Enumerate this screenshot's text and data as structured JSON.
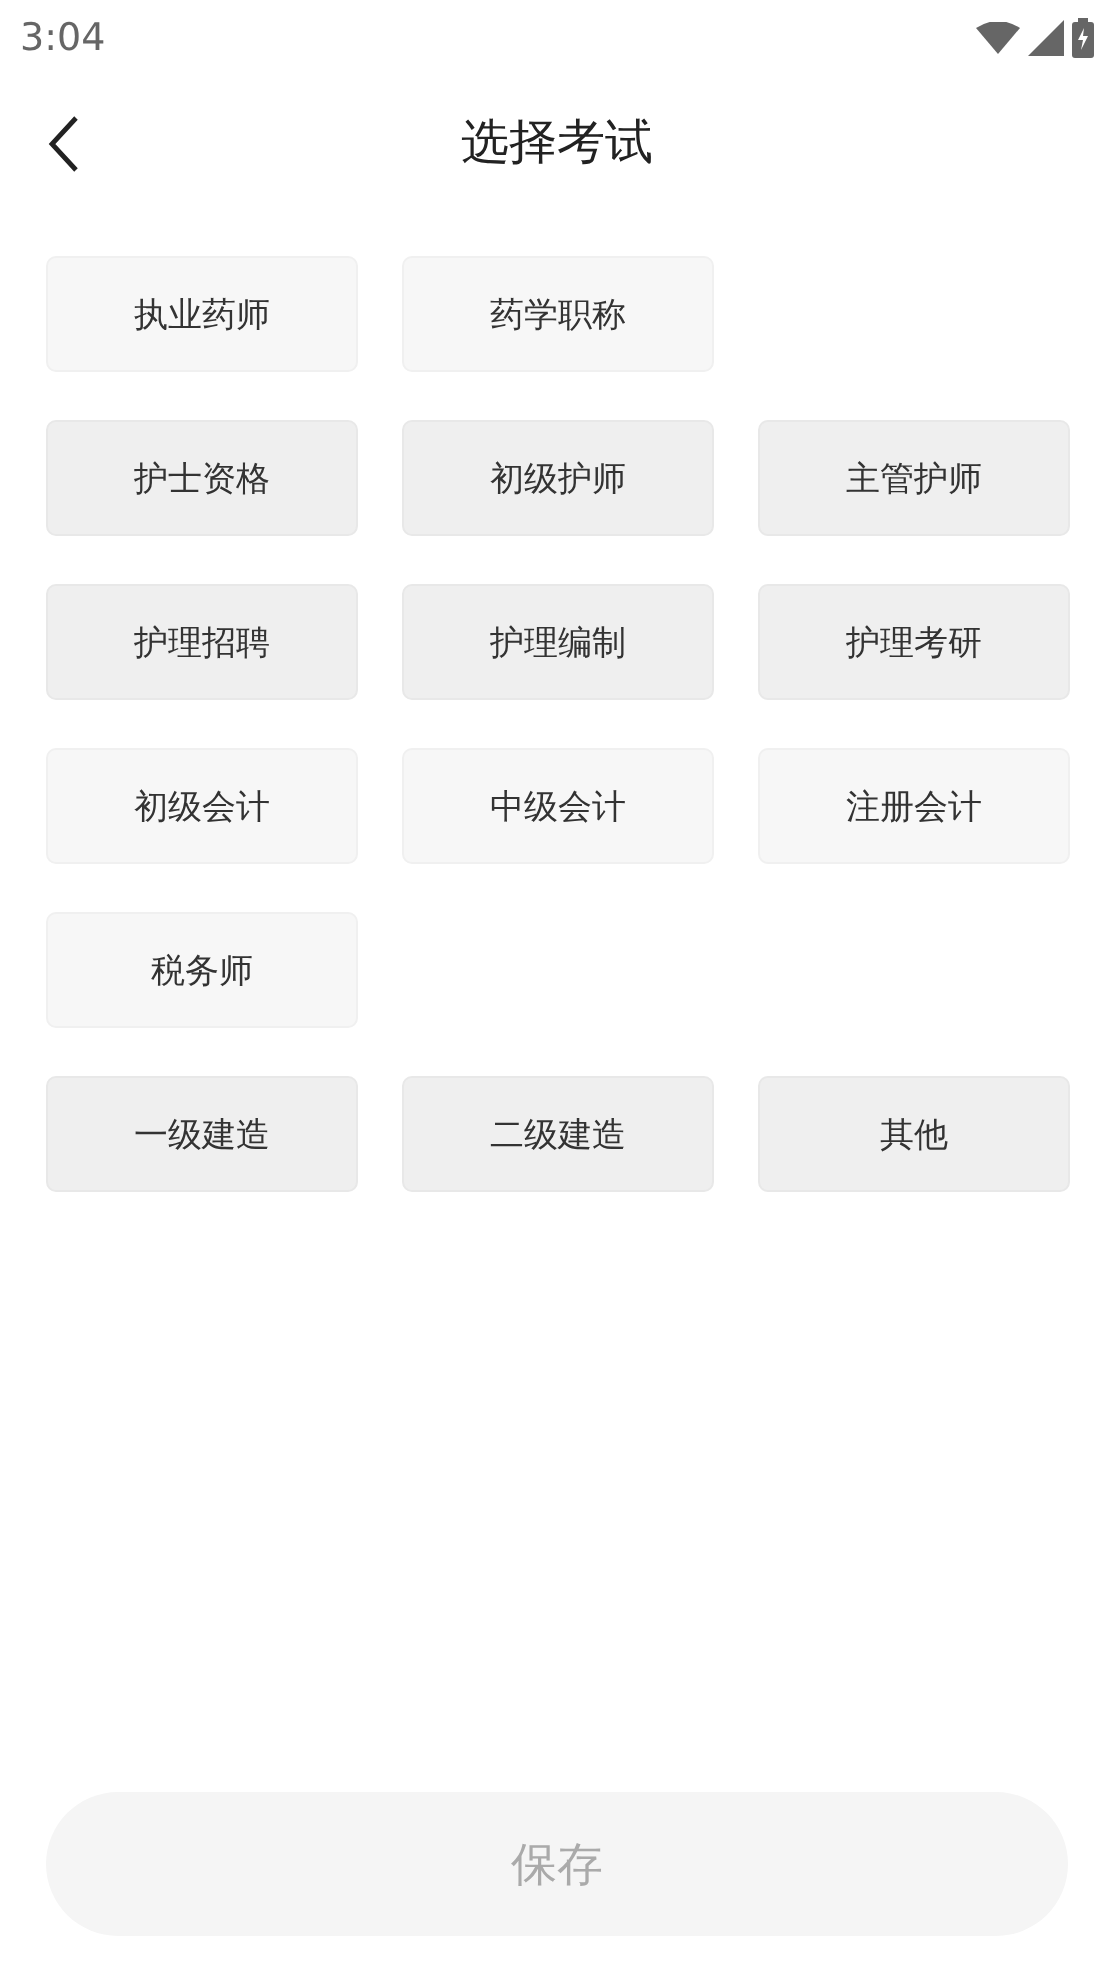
{
  "status_bar": {
    "time": "3:04"
  },
  "header": {
    "title": "选择考试"
  },
  "sections": [
    {
      "items": [
        "执业药师",
        "药学职称"
      ]
    },
    {
      "items": [
        "护士资格",
        "初级护师",
        "主管护师",
        "护理招聘",
        "护理编制",
        "护理考研"
      ]
    },
    {
      "items": [
        "初级会计",
        "中级会计",
        "注册会计",
        "税务师"
      ]
    },
    {
      "items": [
        "一级建造",
        "二级建造",
        "其他"
      ]
    }
  ],
  "save_button": {
    "label": "保存",
    "disabled": true
  }
}
